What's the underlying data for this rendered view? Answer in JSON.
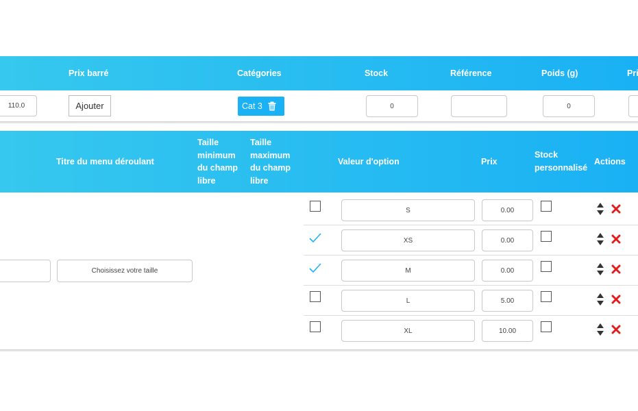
{
  "product_table": {
    "headers": {
      "compare_price": "Prix barré",
      "categories": "Catégories",
      "stock": "Stock",
      "reference": "Référence",
      "weight": "Poids (g)",
      "price_cut": "Pri"
    },
    "row": {
      "price_value": "110.0",
      "add_button": "Ajouter",
      "category_badge": "Cat 3",
      "stock_value": "0",
      "reference_value": "",
      "weight_value": "0"
    }
  },
  "options_table": {
    "headers": {
      "dropdown_title": "Titre du menu déroulant",
      "min_size_lines": [
        "Taille",
        "minimum",
        "du champ",
        "libre"
      ],
      "max_size_lines": [
        "Taille",
        "maximum",
        "du champ",
        "libre"
      ],
      "option_value": "Valeur d'option",
      "price": "Prix",
      "custom_stock_lines": [
        "Stock",
        "personnalisé"
      ],
      "actions": "Actions"
    },
    "dropdown_title_value": "Choisissez votre taille",
    "rows": [
      {
        "checked": false,
        "value": "S",
        "price": "0.00"
      },
      {
        "checked": true,
        "value": "XS",
        "price": "0.00"
      },
      {
        "checked": true,
        "value": "M",
        "price": "0.00"
      },
      {
        "checked": false,
        "value": "L",
        "price": "5.00"
      },
      {
        "checked": false,
        "value": "XL",
        "price": "10.00"
      }
    ]
  },
  "colors": {
    "header_gradient_start": "#36c8ee",
    "header_gradient_end": "#1ab1f4",
    "check_color": "#1ab2f5",
    "delete_color": "#e31b1b",
    "badge_color": "#1ab2f5"
  },
  "icons": {
    "category_delete": "trash-icon",
    "row_move": "sort-arrows-icon",
    "row_delete": "close-icon",
    "row_checked": "check-icon"
  }
}
